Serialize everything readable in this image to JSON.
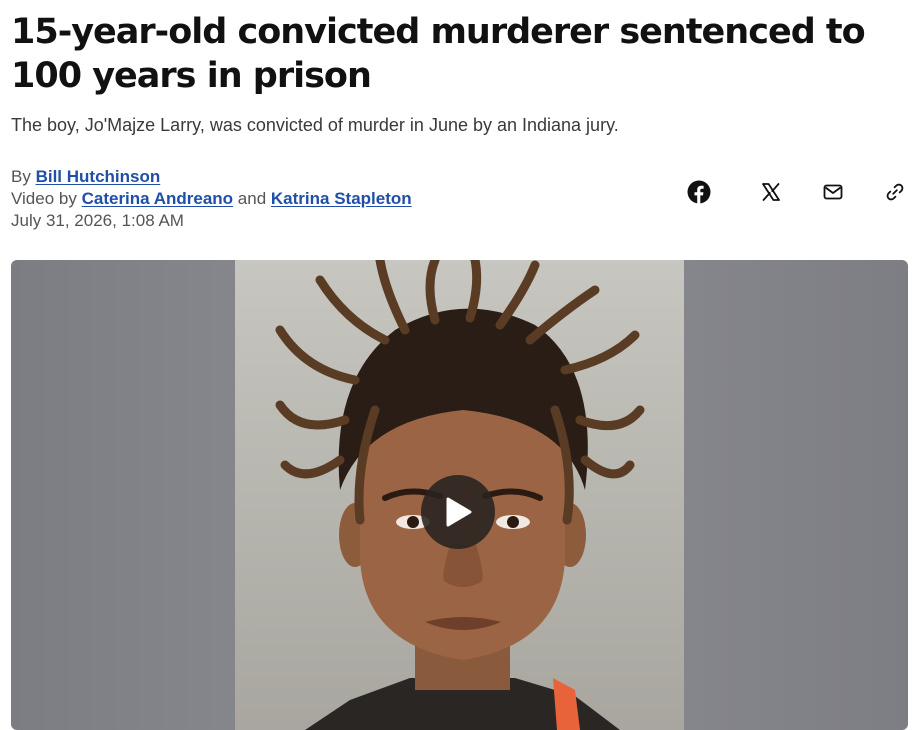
{
  "article": {
    "headline": "15-year-old convicted murderer sentenced to 100 years in prison",
    "subheadline": "The boy, Jo'Majze Larry, was convicted of murder in June by an Indiana jury.",
    "byline": {
      "by_prefix": "By",
      "author": "Bill Hutchinson",
      "video_prefix": "Video by",
      "video_author_1": "Caterina Andreano",
      "conjunction": "and",
      "video_author_2": "Katrina Stapleton",
      "date": "July 31, 2026, 1:08 AM"
    }
  },
  "share": {
    "icons": [
      "facebook-icon",
      "x-icon",
      "mail-icon",
      "link-icon"
    ]
  },
  "media": {
    "play_icon": "play-icon"
  },
  "colors": {
    "headline": "#111111",
    "link": "#1f4fa8",
    "meta_text": "#555555",
    "video_background": "#85868c",
    "play_button": "#282220"
  }
}
